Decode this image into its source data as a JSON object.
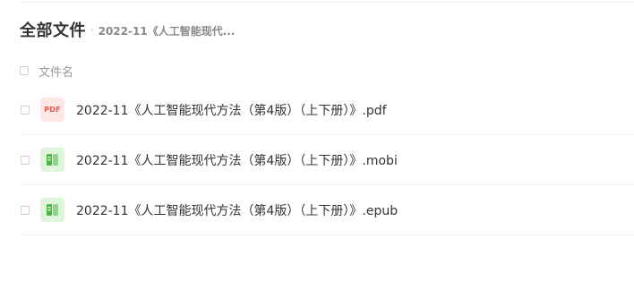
{
  "header": {
    "root_title": "全部文件",
    "separator": "›",
    "current_folder": "2022-11《人工智能现代..."
  },
  "list": {
    "column_label": "文件名",
    "files": [
      {
        "name": "2022-11《人工智能现代方法（第4版）（上下册）》.pdf",
        "icon": "pdf-icon",
        "icon_text": "PDF"
      },
      {
        "name": "2022-11《人工智能现代方法（第4版）（上下册）》.mobi",
        "icon": "ebook-icon"
      },
      {
        "name": "2022-11《人工智能现代方法（第4版）（上下册）》.epub",
        "icon": "ebook-icon"
      }
    ]
  },
  "colors": {
    "pdf_icon_bg": "#fde8e6",
    "pdf_icon_text": "#e8584f",
    "ebook_icon_bg": "#dff5dc",
    "ebook_icon_fg": "#4cb944"
  }
}
